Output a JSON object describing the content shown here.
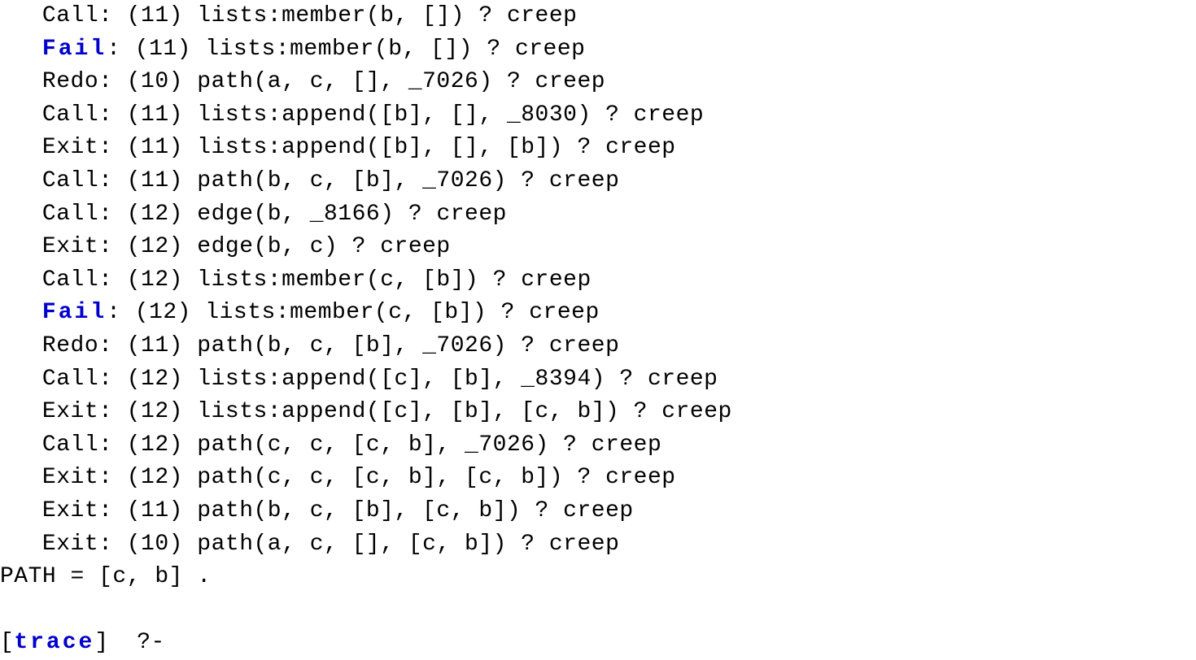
{
  "prefix_indent": "   ",
  "lines": [
    {
      "port": "Call",
      "colored": false,
      "depth": "(11)",
      "goal": "lists:member(b, [])",
      "after": " ? creep"
    },
    {
      "port": "Fail",
      "colored": true,
      "depth": "(11)",
      "goal": "lists:member(b, [])",
      "after": " ? creep"
    },
    {
      "port": "Redo",
      "colored": false,
      "depth": "(10)",
      "goal": "path(a, c, [], _7026)",
      "after": " ? creep"
    },
    {
      "port": "Call",
      "colored": false,
      "depth": "(11)",
      "goal": "lists:append([b], [], _8030)",
      "after": " ? creep"
    },
    {
      "port": "Exit",
      "colored": false,
      "depth": "(11)",
      "goal": "lists:append([b], [], [b])",
      "after": " ? creep"
    },
    {
      "port": "Call",
      "colored": false,
      "depth": "(11)",
      "goal": "path(b, c, [b], _7026)",
      "after": " ? creep"
    },
    {
      "port": "Call",
      "colored": false,
      "depth": "(12)",
      "goal": "edge(b, _8166)",
      "after": " ? creep"
    },
    {
      "port": "Exit",
      "colored": false,
      "depth": "(12)",
      "goal": "edge(b, c)",
      "after": " ? creep"
    },
    {
      "port": "Call",
      "colored": false,
      "depth": "(12)",
      "goal": "lists:member(c, [b])",
      "after": " ? creep"
    },
    {
      "port": "Fail",
      "colored": true,
      "depth": "(12)",
      "goal": "lists:member(c, [b])",
      "after": " ? creep"
    },
    {
      "port": "Redo",
      "colored": false,
      "depth": "(11)",
      "goal": "path(b, c, [b], _7026)",
      "after": " ? creep"
    },
    {
      "port": "Call",
      "colored": false,
      "depth": "(12)",
      "goal": "lists:append([c], [b], _8394)",
      "after": " ? creep"
    },
    {
      "port": "Exit",
      "colored": false,
      "depth": "(12)",
      "goal": "lists:append([c], [b], [c, b])",
      "after": " ? creep"
    },
    {
      "port": "Call",
      "colored": false,
      "depth": "(12)",
      "goal": "path(c, c, [c, b], _7026)",
      "after": " ? creep"
    },
    {
      "port": "Exit",
      "colored": false,
      "depth": "(12)",
      "goal": "path(c, c, [c, b], [c, b])",
      "after": " ? creep"
    },
    {
      "port": "Exit",
      "colored": false,
      "depth": "(11)",
      "goal": "path(b, c, [b], [c, b])",
      "after": " ? creep"
    },
    {
      "port": "Exit",
      "colored": false,
      "depth": "(10)",
      "goal": "path(a, c, [], [c, b])",
      "after": " ? creep"
    }
  ],
  "result_line": "PATH = [c, b] .",
  "prompt": {
    "bracket_left": "[",
    "trace": "trace",
    "bracket_right": "]",
    "tail": "  ?-"
  }
}
